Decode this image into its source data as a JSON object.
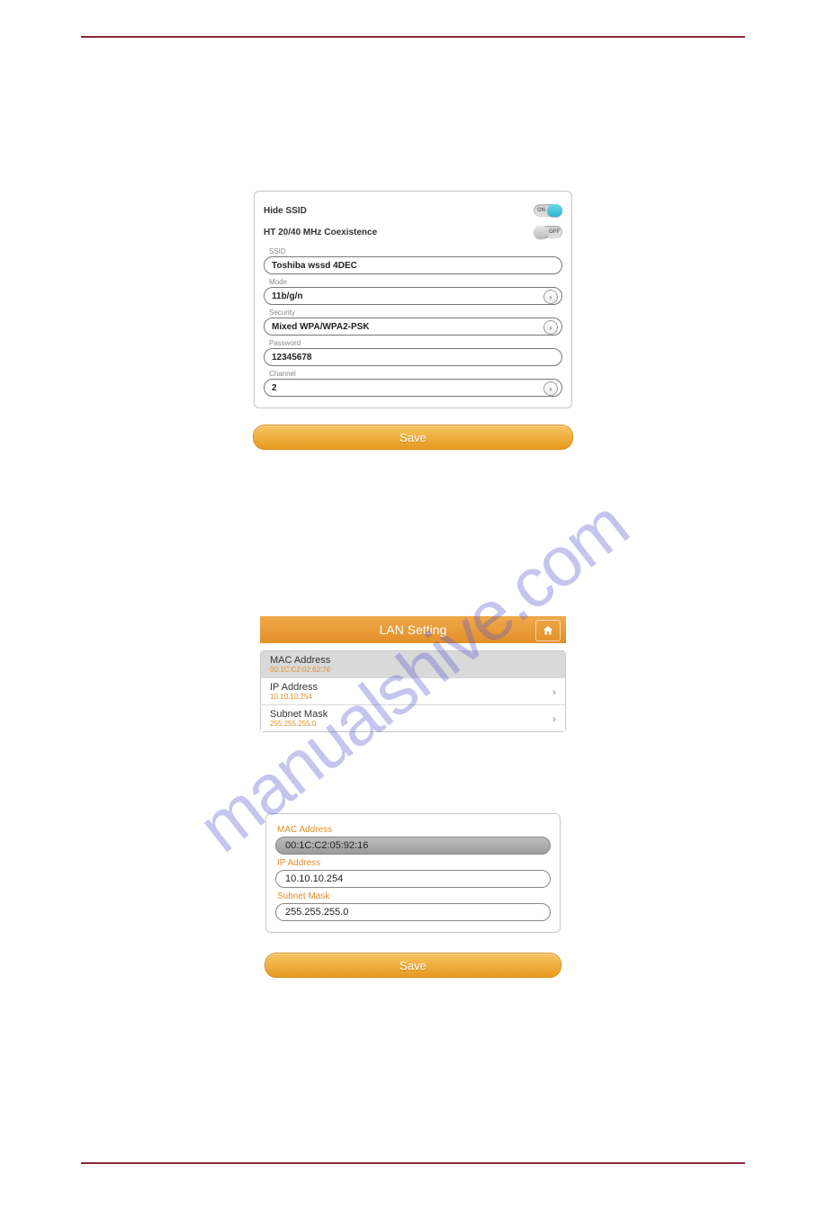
{
  "watermark": "manualshive.com",
  "wifi_panel": {
    "hide_ssid_label": "Hide SSID",
    "hide_ssid_state": "ON",
    "coexist_label": "HT 20/40 MHz Coexistence",
    "coexist_state": "OFF",
    "ssid_label": "SSID",
    "ssid_value": "Toshiba wssd 4DEC",
    "mode_label": "Mode",
    "mode_value": "11b/g/n",
    "security_label": "Security",
    "security_value": "Mixed WPA/WPA2-PSK",
    "password_label": "Password",
    "password_value": "12345678",
    "channel_label": "Channel",
    "channel_value": "2",
    "save_label": "Save"
  },
  "lan_block": {
    "header": "LAN Setting",
    "rows": [
      {
        "title": "MAC Address",
        "value": "00:1C:C2:02:62:76"
      },
      {
        "title": "IP Address",
        "value": "10.10.10.254"
      },
      {
        "title": "Subnet Mask",
        "value": "255.255.255.0"
      }
    ]
  },
  "lan_edit": {
    "mac_label": "MAC Address",
    "mac_value": "00:1C:C2:05:92:16",
    "ip_label": "IP Address",
    "ip_value": "10.10.10.254",
    "subnet_label": "Subnet Mask",
    "subnet_value": "255.255.255.0",
    "save_label": "Save"
  }
}
